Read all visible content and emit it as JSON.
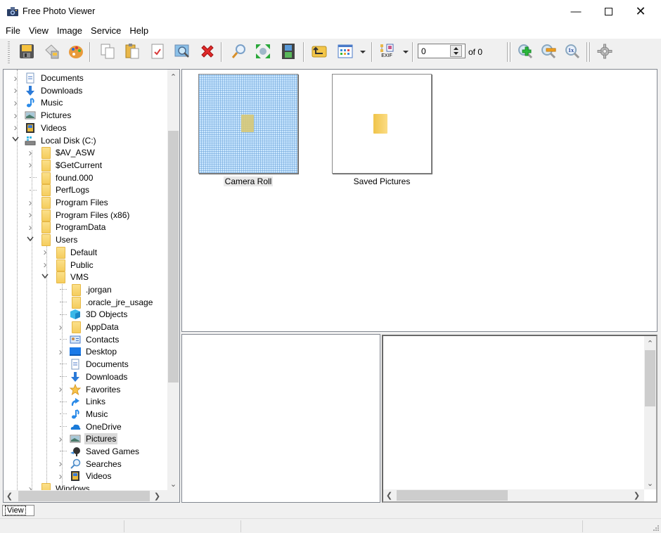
{
  "window": {
    "title": "Free Photo Viewer",
    "icon": "camera-icon",
    "controls": [
      "minimize",
      "maximize",
      "close"
    ]
  },
  "menubar": {
    "items": [
      {
        "label": "File"
      },
      {
        "label": "View"
      },
      {
        "label": "Image"
      },
      {
        "label": "Service"
      },
      {
        "label": "Help"
      }
    ]
  },
  "toolbar": {
    "buttons": [
      {
        "name": "save",
        "icon": "floppy-disk-icon"
      },
      {
        "name": "scanner",
        "icon": "scanner-icon"
      },
      {
        "name": "palette",
        "icon": "palette-icon"
      },
      {
        "name": "copy",
        "icon": "copy-icon"
      },
      {
        "name": "paste",
        "icon": "paste-icon"
      },
      {
        "name": "checklist",
        "icon": "check-document-icon"
      },
      {
        "name": "preview",
        "icon": "magnify-picture-icon"
      },
      {
        "name": "delete",
        "icon": "red-x-icon"
      },
      {
        "name": "search",
        "icon": "search-icon"
      },
      {
        "name": "fullscreen",
        "icon": "fullscreen-icon"
      },
      {
        "name": "slideshow",
        "icon": "filmstrip-icon"
      },
      {
        "name": "up-folder",
        "icon": "folder-up-icon"
      },
      {
        "name": "view-mode",
        "icon": "thumbnails-icon"
      },
      {
        "name": "exif",
        "icon": "exif-icon",
        "label": "EXIF"
      },
      {
        "name": "zoom-in",
        "icon": "zoom-in-icon"
      },
      {
        "name": "zoom-out",
        "icon": "zoom-out-icon"
      },
      {
        "name": "zoom-1x",
        "icon": "zoom-actual-icon",
        "label": "1x"
      },
      {
        "name": "settings",
        "icon": "gear-icon"
      }
    ],
    "page_value": "0",
    "of_label": "of 0"
  },
  "tree": {
    "items": [
      {
        "label": "Documents",
        "icon": "documents-icon",
        "level": 1,
        "expander": "collapsed"
      },
      {
        "label": "Downloads",
        "icon": "downloads-icon",
        "level": 1,
        "expander": "collapsed"
      },
      {
        "label": "Music",
        "icon": "music-icon",
        "level": 1,
        "expander": "collapsed"
      },
      {
        "label": "Pictures",
        "icon": "pictures-icon",
        "level": 1,
        "expander": "collapsed"
      },
      {
        "label": "Videos",
        "icon": "videos-icon",
        "level": 1,
        "expander": "collapsed"
      },
      {
        "label": "Local Disk (C:)",
        "icon": "drive-icon",
        "level": 1,
        "expander": "expanded"
      },
      {
        "label": "$AV_ASW",
        "icon": "folder-icon",
        "level": 2,
        "expander": "collapsed"
      },
      {
        "label": "$GetCurrent",
        "icon": "folder-icon",
        "level": 2,
        "expander": "collapsed"
      },
      {
        "label": "found.000",
        "icon": "folder-icon",
        "level": 2,
        "expander": "none"
      },
      {
        "label": "PerfLogs",
        "icon": "folder-icon",
        "level": 2,
        "expander": "none"
      },
      {
        "label": "Program Files",
        "icon": "folder-icon",
        "level": 2,
        "expander": "collapsed"
      },
      {
        "label": "Program Files (x86)",
        "icon": "folder-icon",
        "level": 2,
        "expander": "collapsed"
      },
      {
        "label": "ProgramData",
        "icon": "folder-icon",
        "level": 2,
        "expander": "collapsed"
      },
      {
        "label": "Users",
        "icon": "folder-icon",
        "level": 2,
        "expander": "expanded"
      },
      {
        "label": "Default",
        "icon": "folder-icon",
        "level": 3,
        "expander": "collapsed"
      },
      {
        "label": "Public",
        "icon": "folder-icon",
        "level": 3,
        "expander": "collapsed"
      },
      {
        "label": "VMS",
        "icon": "folder-icon",
        "level": 3,
        "expander": "expanded"
      },
      {
        "label": ".jorgan",
        "icon": "folder-icon",
        "level": 4,
        "expander": "none"
      },
      {
        "label": ".oracle_jre_usage",
        "icon": "folder-icon",
        "level": 4,
        "expander": "none"
      },
      {
        "label": "3D Objects",
        "icon": "3d-objects-icon",
        "level": 4,
        "expander": "none"
      },
      {
        "label": "AppData",
        "icon": "folder-icon",
        "level": 4,
        "expander": "collapsed"
      },
      {
        "label": "Contacts",
        "icon": "contacts-icon",
        "level": 4,
        "expander": "none"
      },
      {
        "label": "Desktop",
        "icon": "desktop-icon",
        "level": 4,
        "expander": "collapsed"
      },
      {
        "label": "Documents",
        "icon": "documents-icon",
        "level": 4,
        "expander": "none"
      },
      {
        "label": "Downloads",
        "icon": "downloads-icon",
        "level": 4,
        "expander": "none"
      },
      {
        "label": "Favorites",
        "icon": "star-icon",
        "level": 4,
        "expander": "collapsed"
      },
      {
        "label": "Links",
        "icon": "links-icon",
        "level": 4,
        "expander": "none"
      },
      {
        "label": "Music",
        "icon": "music-icon",
        "level": 4,
        "expander": "none"
      },
      {
        "label": "OneDrive",
        "icon": "onedrive-icon",
        "level": 4,
        "expander": "none"
      },
      {
        "label": "Pictures",
        "icon": "pictures-icon",
        "level": 4,
        "expander": "collapsed",
        "selected": true
      },
      {
        "label": "Saved Games",
        "icon": "saved-games-icon",
        "level": 4,
        "expander": "none"
      },
      {
        "label": "Searches",
        "icon": "search-icon",
        "level": 4,
        "expander": "collapsed"
      },
      {
        "label": "Videos",
        "icon": "videos-icon",
        "level": 4,
        "expander": "collapsed"
      },
      {
        "label": "Windows",
        "icon": "folder-icon",
        "level": 2,
        "expander": "collapsed"
      }
    ]
  },
  "thumbnails": {
    "items": [
      {
        "label": "Camera Roll",
        "selected": true
      },
      {
        "label": "Saved Pictures",
        "selected": false
      }
    ]
  },
  "bottom_tabs": {
    "view_label": "View"
  },
  "colors": {
    "selection": "#cce8ff",
    "folder": "#f5cd5e"
  }
}
